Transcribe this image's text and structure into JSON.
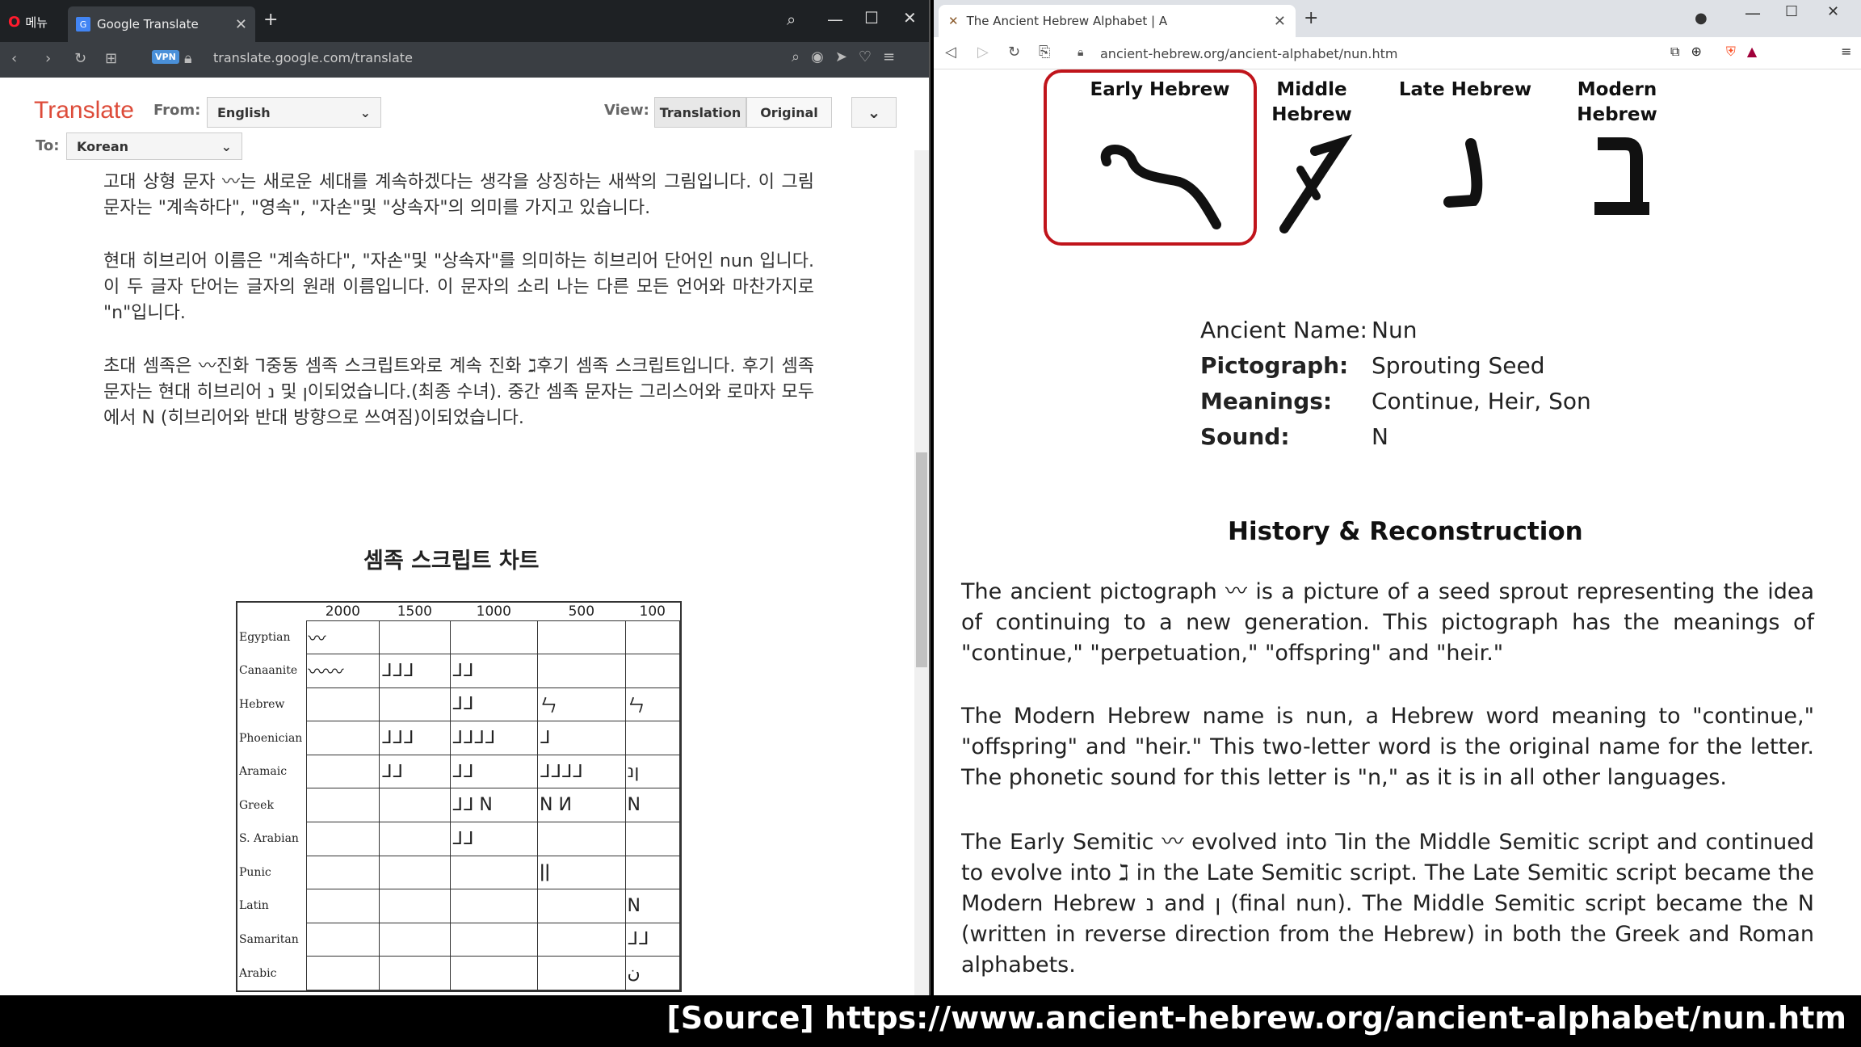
{
  "left_window": {
    "menu_label": "메뉴",
    "tab_title": "Google Translate",
    "url": "translate.google.com/translate",
    "vpn_badge": "VPN",
    "translate_logo": "Translate",
    "from_label": "From:",
    "from_value": "English",
    "to_label": "To:",
    "to_value": "Korean",
    "view_label": "View:",
    "view_translation": "Translation",
    "view_original": "Original",
    "paragraphs": {
      "p1": "고대 상형 문자 〰는 새로운 세대를 계속하겠다는 생각을 상징하는 새싹의 그림입니다. 이 그림 문자는 \"계속하다\", \"영속\", \"자손\"및 \"상속자\"의 의미를 가지고 있습니다.",
      "p2": "현대 히브리어 이름은 \"계속하다\", \"자손\"및 \"상속자\"를 의미하는 히브리어 단어인 nun 입니다. 이 두 글자 단어는 글자의 원래 이름입니다. 이 문자의 소리 나는 다른 모든 언어와 마찬가지로 \"n\"입니다.",
      "p3": "초대 셈족은 〰진화 ⅂중동 셈족 스크립트와로 계속 진화 ℷ후기 셈족 스크립트입니다. 후기 셈족 문자는 현대 히브리어 נ 및 ן이되었습니다.(최종 수녀). 중간 셈족 문자는 그리스어와 로마자 모두에서 N (히브리어와 반대 방향으로 쓰여짐)이되었습니다."
    },
    "chart_heading": "셈족 스크립트 차트",
    "table": {
      "years": [
        "2000",
        "1500",
        "1000",
        "500",
        "100"
      ],
      "rows": [
        {
          "name": "Egyptian",
          "cells": [
            "〰",
            "",
            "",
            "",
            ""
          ]
        },
        {
          "name": "Canaanite",
          "cells": [
            "〰〰",
            "ᒧᒧᒧ",
            "ᒧᒧ",
            "",
            ""
          ]
        },
        {
          "name": "Hebrew",
          "cells": [
            "",
            "",
            "ᒧᒧ",
            "ㄣ",
            "ㄣ"
          ]
        },
        {
          "name": "Phoenician",
          "cells": [
            "",
            "ᒧᒧᒧ",
            "ᒧᒧᒧᒧ",
            "ᒧ",
            ""
          ]
        },
        {
          "name": "Aramaic",
          "cells": [
            "",
            "ᒧᒧ",
            "ᒧᒧ",
            "ᒧᒧᒧᒧ",
            "ןנ"
          ]
        },
        {
          "name": "Greek",
          "cells": [
            "",
            "",
            "ᒧᒧ N",
            "N И",
            "N"
          ]
        },
        {
          "name": "S. Arabian",
          "cells": [
            "",
            "",
            "ᒧᒧ",
            "",
            ""
          ]
        },
        {
          "name": "Punic",
          "cells": [
            "",
            "",
            "",
            "ǀǀ",
            ""
          ]
        },
        {
          "name": "Latin",
          "cells": [
            "",
            "",
            "",
            "",
            "N"
          ]
        },
        {
          "name": "Samaritan",
          "cells": [
            "",
            "",
            "",
            "",
            "ᒧᒧ"
          ]
        },
        {
          "name": "Arabic",
          "cells": [
            "",
            "",
            "",
            "",
            "ن"
          ]
        }
      ]
    }
  },
  "right_window": {
    "tab_title": "The Ancient Hebrew Alphabet | A",
    "url": "ancient-hebrew.org/ancient-alphabet/nun.htm",
    "columns": {
      "early": "Early Hebrew",
      "middle": "Middle Hebrew",
      "late": "Late Hebrew",
      "modern": "Modern Hebrew"
    },
    "info": {
      "ancient_name_label": "Ancient Name:",
      "ancient_name_value": "Nun",
      "pictograph_label": "Pictograph:",
      "pictograph_value": "Sprouting Seed",
      "meanings_label": "Meanings:",
      "meanings_value": "Continue, Heir, Son",
      "sound_label": "Sound:",
      "sound_value": "N"
    },
    "history_heading": "History & Reconstruction",
    "history_p1": "The ancient pictograph 〰 is a picture of a seed sprout representing the idea of continuing to a new generation. This pictograph has the meanings of \"continue,\" \"perpetuation,\" \"offspring\" and \"heir.\"",
    "history_p2": "The Modern Hebrew name is nun, a Hebrew word meaning to \"continue,\" \"offspring\" and \"heir.\" This two-letter word is the original name for the letter. The phonetic sound for this letter is \"n,\" as it is in all other languages.",
    "history_p3": "The Early Semitic 〰 evolved into ⅂in the Middle Semitic script and continued to evolve into ℷ in the Late Semitic script. The Late Semitic script became the Modern Hebrew נ and ן (final nun). The Middle Semitic script became the N (written in reverse direction from the Hebrew) in both the Greek and Roman alphabets."
  },
  "banner": "[Source]  https://www.ancient-hebrew.org/ancient-alphabet/nun.htm"
}
